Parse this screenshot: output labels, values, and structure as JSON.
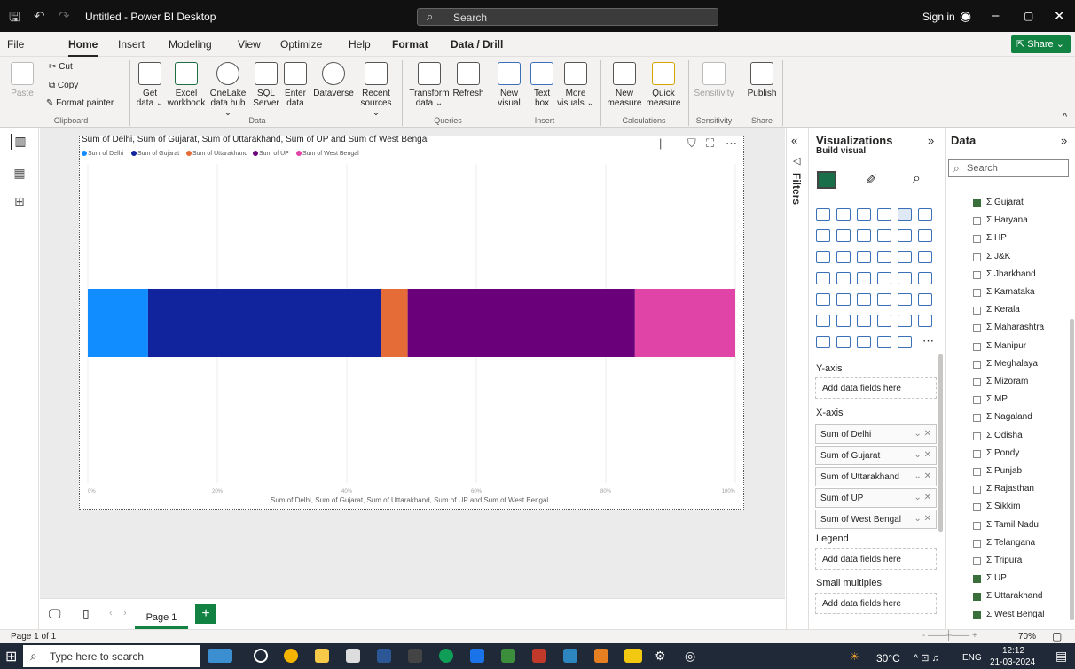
{
  "window": {
    "title": "Untitled - Power BI Desktop",
    "search": "Search",
    "sign_in": "Sign in"
  },
  "menu": {
    "items": [
      "File",
      "Home",
      "Insert",
      "Modeling",
      "View",
      "Optimize",
      "Help",
      "Format",
      "Data / Drill"
    ],
    "active": "Home",
    "share": "Share"
  },
  "ribbon": {
    "clipboard": {
      "paste": "Paste",
      "cut": "Cut",
      "copy": "Copy",
      "format_painter": "Format painter",
      "group": "Clipboard"
    },
    "data": {
      "get_data": "Get data ⌄",
      "excel": "Excel workbook",
      "onelake": "OneLake data hub ⌄",
      "sql": "SQL Server",
      "enter": "Enter data",
      "dataverse": "Dataverse",
      "recent": "Recent sources ⌄",
      "group": "Data"
    },
    "queries": {
      "transform": "Transform data ⌄",
      "refresh": "Refresh",
      "group": "Queries"
    },
    "insert": {
      "new_visual": "New visual",
      "text_box": "Text box",
      "more_visuals": "More visuals ⌄",
      "group": "Insert"
    },
    "calculations": {
      "new_measure": "New measure",
      "quick_measure": "Quick measure",
      "group": "Calculations"
    },
    "sensitivity": {
      "label": "Sensitivity",
      "group": "Sensitivity"
    },
    "share": {
      "publish": "Publish",
      "group": "Share"
    }
  },
  "chart_data": {
    "type": "bar",
    "title": "Sum of Delhi, Sum of Gujarat, Sum of Uttarakhand, Sum of UP and Sum of West Bengal",
    "xlabel": "Sum of Delhi, Sum of Gujarat, Sum of Uttarakhand, Sum of UP and Sum of West Bengal",
    "stacked_percent": true,
    "x_ticks": [
      "0%",
      "20%",
      "40%",
      "60%",
      "80%",
      "100%"
    ],
    "xlim": [
      0,
      100
    ],
    "legend_position": "top-left",
    "series": [
      {
        "name": "Sum of Delhi",
        "value": 9.3,
        "color": "#118dff"
      },
      {
        "name": "Sum of Gujarat",
        "value": 36.0,
        "color": "#12239e"
      },
      {
        "name": "Sum of Uttarakhand",
        "value": 4.1,
        "color": "#e66c37"
      },
      {
        "name": "Sum of UP",
        "value": 35.1,
        "color": "#6b007b"
      },
      {
        "name": "Sum of West Bengal",
        "value": 15.5,
        "color": "#e044a7"
      }
    ]
  },
  "pages": {
    "tab": "Page 1",
    "add": "+"
  },
  "filters": {
    "label": "Filters"
  },
  "visualizations": {
    "title": "Visualizations",
    "build_visual": "Build visual",
    "y_axis": "Y-axis",
    "y_placeholder": "Add data fields here",
    "x_axis": "X-axis",
    "x_fields": [
      "Sum of Delhi",
      "Sum of Gujarat",
      "Sum of Uttarakhand",
      "Sum of UP",
      "Sum of West Bengal"
    ],
    "legend": "Legend",
    "legend_placeholder": "Add data fields here",
    "small_multiples": "Small multiples",
    "sm_placeholder": "Add data fields here"
  },
  "data_pane": {
    "title": "Data",
    "search": "Search",
    "fields": [
      {
        "name": "Gujarat",
        "checked": true
      },
      {
        "name": "Haryana",
        "checked": false
      },
      {
        "name": "HP",
        "checked": false
      },
      {
        "name": "J&K",
        "checked": false
      },
      {
        "name": "Jharkhand",
        "checked": false
      },
      {
        "name": "Karnataka",
        "checked": false
      },
      {
        "name": "Kerala",
        "checked": false
      },
      {
        "name": "Maharashtra",
        "checked": false
      },
      {
        "name": "Manipur",
        "checked": false
      },
      {
        "name": "Meghalaya",
        "checked": false
      },
      {
        "name": "Mizoram",
        "checked": false
      },
      {
        "name": "MP",
        "checked": false
      },
      {
        "name": "Nagaland",
        "checked": false
      },
      {
        "name": "Odisha",
        "checked": false
      },
      {
        "name": "Pondy",
        "checked": false
      },
      {
        "name": "Punjab",
        "checked": false
      },
      {
        "name": "Rajasthan",
        "checked": false
      },
      {
        "name": "Sikkim",
        "checked": false
      },
      {
        "name": "Tamil Nadu",
        "checked": false
      },
      {
        "name": "Telangana",
        "checked": false
      },
      {
        "name": "Tripura",
        "checked": false
      },
      {
        "name": "UP",
        "checked": true
      },
      {
        "name": "Uttarakhand",
        "checked": true
      },
      {
        "name": "West Bengal",
        "checked": true
      }
    ]
  },
  "status": {
    "page": "Page 1 of 1",
    "zoom": "70%"
  },
  "taskbar": {
    "search": "Type here to search",
    "weather": "30°C",
    "lang": "ENG",
    "time": "12:12",
    "date": "21-03-2024"
  }
}
